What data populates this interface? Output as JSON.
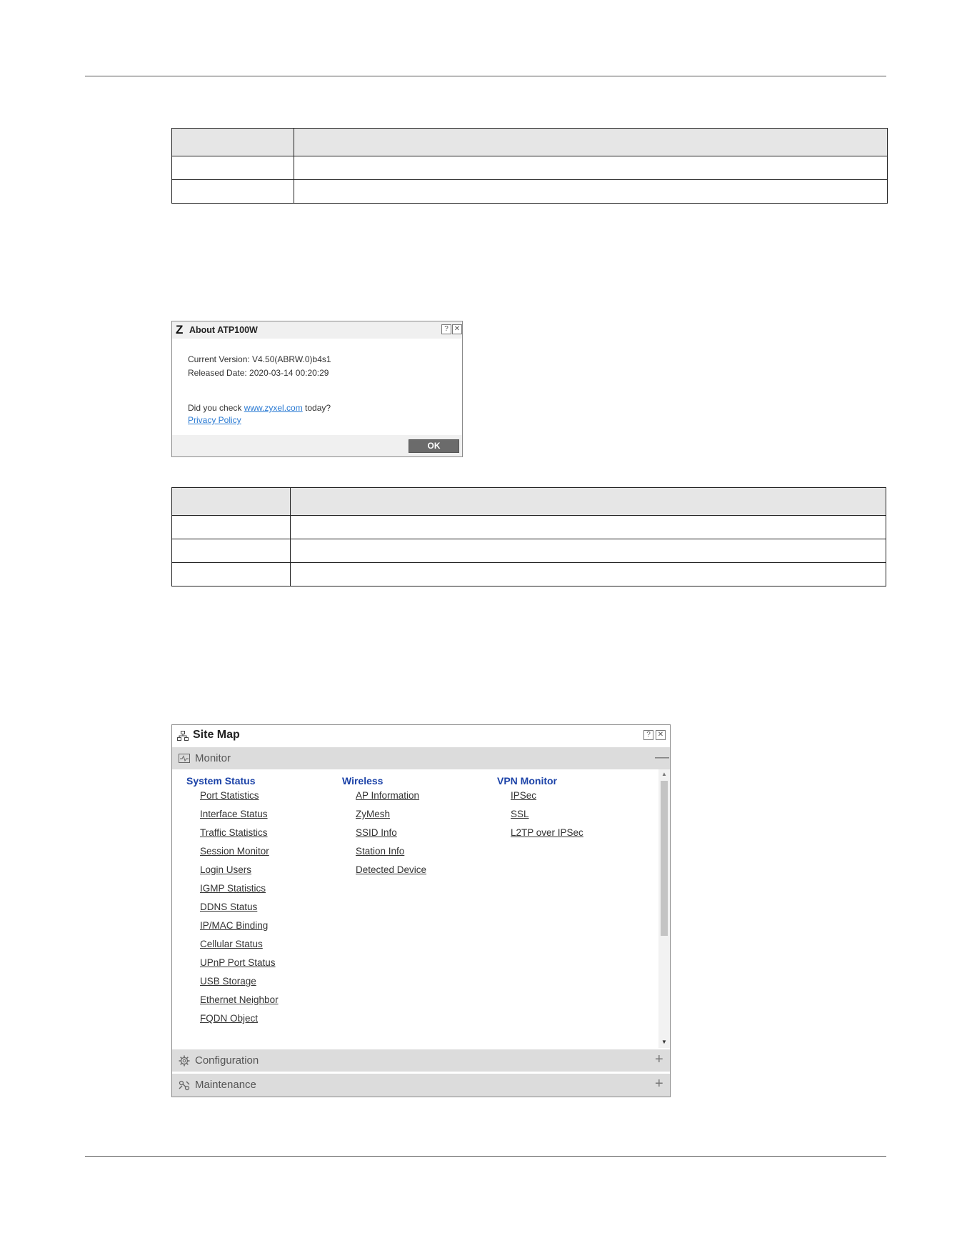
{
  "about_dialog": {
    "logo": "Z",
    "title": "About ATP100W",
    "current_version": "Current Version: V4.50(ABRW.0)b4s1",
    "released_date": "Released Date: 2020-03-14 00:20:29",
    "check_prefix": "Did you check ",
    "check_link": "www.zyxel.com",
    "check_suffix": " today?",
    "privacy_link": "Privacy Policy",
    "ok_label": "OK",
    "help_glyph": "?",
    "close_glyph": "✕"
  },
  "site_map": {
    "title": "Site Map",
    "help_glyph": "?",
    "close_glyph": "✕",
    "sections": {
      "monitor": {
        "label": "Monitor",
        "toggle": "—"
      },
      "configuration": {
        "label": "Configuration",
        "toggle": "+"
      },
      "maintenance": {
        "label": "Maintenance",
        "toggle": "+"
      }
    },
    "columns": [
      {
        "heading": "System Status",
        "links": [
          "Port Statistics",
          "Interface Status",
          "Traffic Statistics",
          "Session Monitor",
          "Login Users",
          "IGMP Statistics",
          "DDNS Status",
          "IP/MAC Binding",
          "Cellular Status",
          "UPnP Port Status",
          "USB Storage",
          "Ethernet Neighbor",
          "FQDN Object"
        ]
      },
      {
        "heading": "Wireless",
        "links": [
          "AP Information",
          "ZyMesh",
          "SSID Info",
          "Station Info",
          "Detected Device"
        ]
      },
      {
        "heading": "VPN Monitor",
        "links": [
          "IPSec",
          "SSL",
          "L2TP over IPSec"
        ]
      }
    ],
    "scroll_up": "▲",
    "scroll_down": "▼"
  }
}
